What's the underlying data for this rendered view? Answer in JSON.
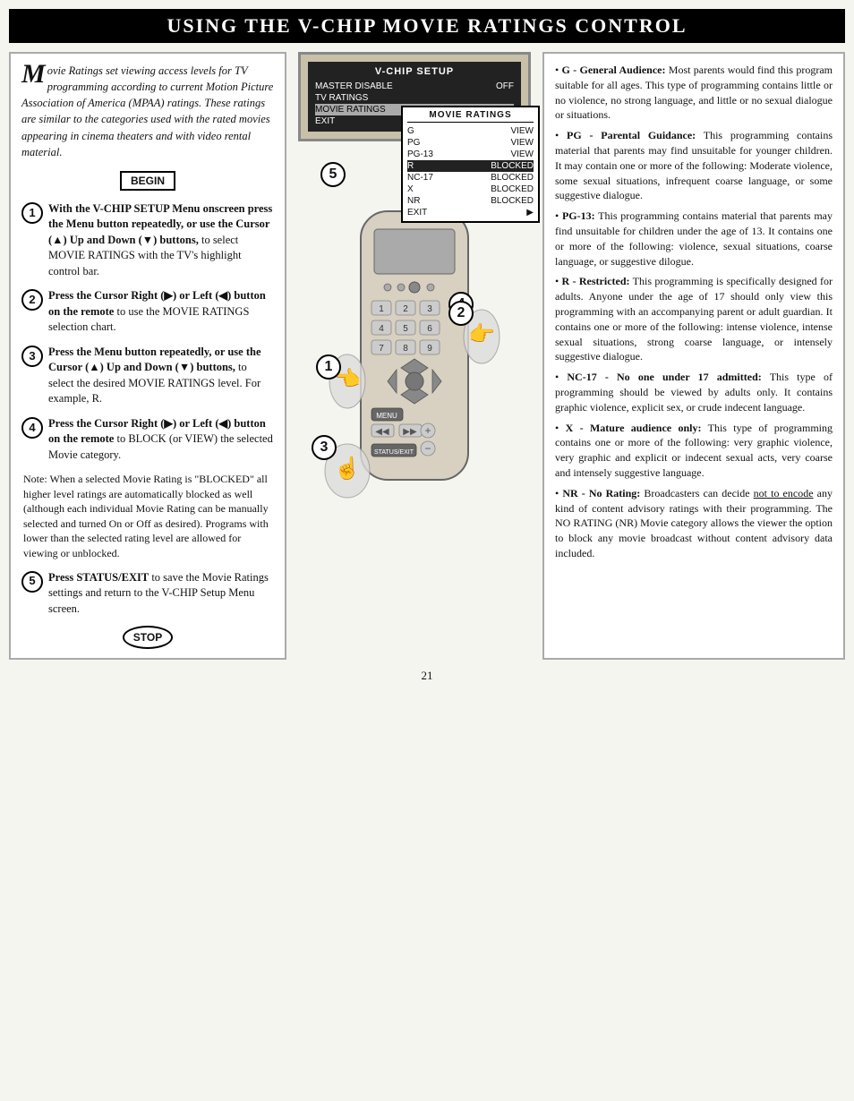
{
  "header": {
    "title": "Using the V-Chip Movie Ratings Control"
  },
  "intro": {
    "drop_cap": "M",
    "text": "ovie Ratings set viewing access levels for TV programming according to current Motion Picture Association of America (MPAA) ratings. These ratings are similar to the categories used with the rated movies appearing in cinema theaters and with video rental material."
  },
  "begin_label": "BEGIN",
  "stop_label": "STOP",
  "steps": [
    {
      "num": "1",
      "bold": "With the V-CHIP SETUP Menu onscreen press the Menu button repeatedly, or use the Cursor (▲) Up and Down (▼) buttons,",
      "normal": " to select MOVIE RATINGS with the TV's highlight control bar."
    },
    {
      "num": "2",
      "bold": "Press the Cursor Right (▶) or Left (◀) button on the remote",
      "normal": " to use the MOVIE RATINGS selection chart."
    },
    {
      "num": "3",
      "bold": "Press the Menu button repeatedly, or use the Cursor (▲) Up and Down (▼) buttons,",
      "normal": " to select the desired MOVIE RATINGS level. For example, R."
    },
    {
      "num": "4",
      "bold": "Press the Cursor Right (▶) or Left (◀) button on the remote",
      "normal": " to BLOCK (or VIEW) the selected Movie category."
    },
    {
      "num": "5",
      "bold": "Press STATUS/EXIT",
      "normal": " to save the Movie Ratings settings and return to the V-CHIP Setup Menu screen."
    }
  ],
  "note_text": "Note: When a selected Movie Rating is \"BLOCKED\" all higher level ratings are automatically blocked as well (although each individual Movie Rating can be manually selected and turned On or Off as desired). Programs with lower than the selected rating level are allowed for viewing or unblocked.",
  "tv_menu": {
    "title": "V-CHIP SETUP",
    "rows": [
      {
        "label": "MASTER DISABLE",
        "value": "OFF"
      },
      {
        "label": "TV RATINGS",
        "value": ""
      },
      {
        "label": "MOVIE RATINGS",
        "value": "▶",
        "highlighted": true
      },
      {
        "label": "EXIT",
        "value": ""
      }
    ]
  },
  "movie_ratings_table": {
    "title": "MOVIE RATINGS",
    "rows": [
      {
        "label": "G",
        "value": "VIEW"
      },
      {
        "label": "PG",
        "value": "VIEW"
      },
      {
        "label": "PG-13",
        "value": "VIEW"
      },
      {
        "label": "R",
        "value": "BLOCKED",
        "highlighted": true
      },
      {
        "label": "NC-17",
        "value": "BLOCKED"
      },
      {
        "label": "X",
        "value": "BLOCKED"
      },
      {
        "label": "NR",
        "value": "BLOCKED"
      },
      {
        "label": "EXIT",
        "value": "▶"
      }
    ]
  },
  "ratings_descriptions": [
    {
      "label": "G - General Audience:",
      "text": " Most parents would find this program suitable for all ages. This type of programming contains little or no violence, no strong language, and little or no sexual dialogue or situations."
    },
    {
      "label": "PG - Parental Guidance:",
      "text": " This programming contains material that parents may find unsuitable for younger children. It may contain one or more of the following: Moderate violence, some sexual situations, infrequent coarse language, or some suggestive dialogue."
    },
    {
      "label": "PG-13:",
      "text": " This programming contains material that parents may find unsuitable for children under the age of 13. It contains one or more of the following: violence, sexual situations, coarse language, or suggestive dilogue."
    },
    {
      "label": "R - Restricted:",
      "text": " This programming is specifically designed for adults. Anyone under the age of 17 should only view this programming with an accompanying parent or adult guardian. It contains one or more of the following: intense violence, intense sexual situations, strong coarse language, or intensely suggestive dialogue."
    },
    {
      "label": "NC-17 - No one under 17 admitted:",
      "text": " This type of programming should be viewed by adults only. It contains graphic violence, explicit sex, or crude indecent language."
    },
    {
      "label": "X - Mature audience only:",
      "text": " This type of programming contains one or more of the following: very graphic violence, very graphic and explicit or indecent sexual acts, very coarse and intensely suggestive language."
    },
    {
      "label": "NR - No Rating:",
      "text": " Broadcasters can decide ",
      "underline": "not to encode",
      "text2": " any kind of content advisory ratings with their programming. The NO RATING (NR) Movie category allows the viewer the option to block any movie broadcast without content advisory data included."
    }
  ],
  "page_number": "21"
}
